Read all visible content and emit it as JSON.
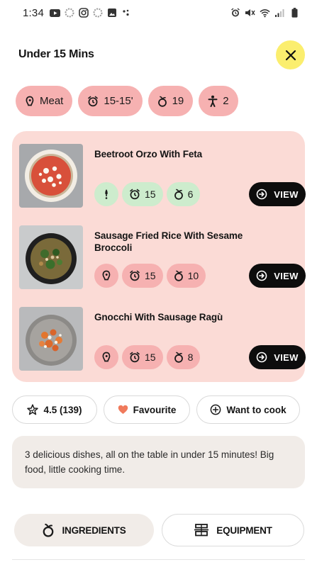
{
  "status_bar": {
    "time": "1:34"
  },
  "header": {
    "title": "Under 15 Mins"
  },
  "tags": [
    {
      "icon": "meat-icon",
      "label": "Meat"
    },
    {
      "icon": "clock-icon",
      "label": "15-15'"
    },
    {
      "icon": "ingredients-icon",
      "label": "19"
    },
    {
      "icon": "person-icon",
      "label": "2"
    }
  ],
  "recipes": [
    {
      "title": "Beetroot Orzo With Feta",
      "diet_icon": "vegetarian-icon",
      "time": "15",
      "ingredients": "6",
      "chip_color": "#cdeccd",
      "view_label": "VIEW"
    },
    {
      "title": "Sausage Fried Rice With Sesame Broccoli",
      "diet_icon": "meat-icon",
      "time": "15",
      "ingredients": "10",
      "chip_color": "#f6b1b1",
      "view_label": "VIEW"
    },
    {
      "title": "Gnocchi With Sausage Ragù",
      "diet_icon": "meat-icon",
      "time": "15",
      "ingredients": "8",
      "chip_color": "#f6b1b1",
      "view_label": "VIEW"
    }
  ],
  "actions": {
    "rating": "4.5 (139)",
    "favourite": "Favourite",
    "want_to_cook": "Want to cook"
  },
  "description": "3 delicious dishes, all on the table in under 15 minutes! Big food, little cooking time.",
  "tabs": {
    "ingredients": "INGREDIENTS",
    "equipment": "EQUIPMENT"
  },
  "colors": {
    "accent_yellow": "#fbee6e",
    "card_pink": "#fbdbd6",
    "pill_pink": "#f6b1b1",
    "veg_green": "#cdeccd",
    "heart_red": "#f07a5c"
  }
}
